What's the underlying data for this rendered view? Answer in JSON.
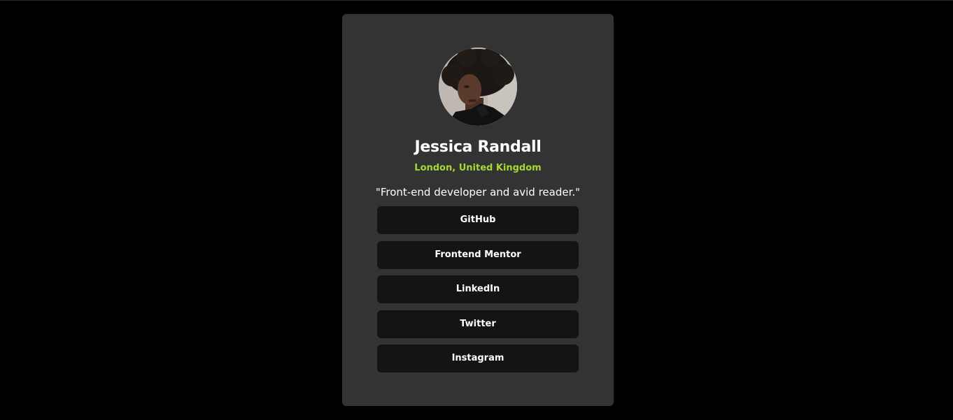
{
  "profile": {
    "name": "Jessica Randall",
    "location": "London, United Kingdom",
    "bio": "\"Front-end developer and avid reader.\"",
    "avatar_icon": "profile-photo"
  },
  "links": [
    {
      "label": "GitHub"
    },
    {
      "label": "Frontend Mentor"
    },
    {
      "label": "LinkedIn"
    },
    {
      "label": "Twitter"
    },
    {
      "label": "Instagram"
    }
  ],
  "colors": {
    "page_background": "#000000",
    "card_background": "#333333",
    "button_background": "#141414",
    "accent": "#a8d633",
    "text": "#ffffff"
  }
}
